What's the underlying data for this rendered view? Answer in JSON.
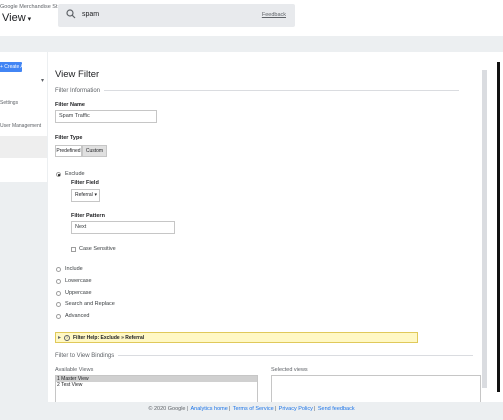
{
  "header": {
    "account_name": "Google Merchandise St...",
    "view_label": "View",
    "search_value": "spam",
    "feedback_label": "Feedback"
  },
  "left_panel": {
    "create_button": "+ Create Account",
    "items": [
      "Settings",
      "User Management"
    ]
  },
  "filter": {
    "page_title": "View Filter",
    "section_info": "Filter Information",
    "name_label": "Filter Name",
    "name_value": "Spam Traffic",
    "type_label": "Filter Type",
    "type_options": [
      "Predefined",
      "Custom"
    ],
    "selected_type": "Custom",
    "exclude_label": "Exclude",
    "field_label": "Filter Field",
    "field_value": "Referral",
    "pattern_label": "Filter Pattern",
    "pattern_value": "Next",
    "case_sensitive_label": "Case Sensitive",
    "other_options": [
      "Include",
      "Lowercase",
      "Uppercase",
      "Search and Replace",
      "Advanced"
    ],
    "help_text": "Filter Help: Exclude  »  Referral",
    "bindings_title": "Filter to View Bindings",
    "available_label": "Available Views",
    "selected_label": "Selected views",
    "available_views": [
      "1 Master View",
      "2 Test View"
    ]
  },
  "footer": {
    "copyright": "© 2020 Google",
    "links": [
      "Analytics home",
      "Terms of Service",
      "Privacy Policy",
      "Send feedback"
    ]
  },
  "colors": {
    "accent": "#4285f4",
    "help_bg": "#fff8c4",
    "link": "#1a73e8"
  }
}
